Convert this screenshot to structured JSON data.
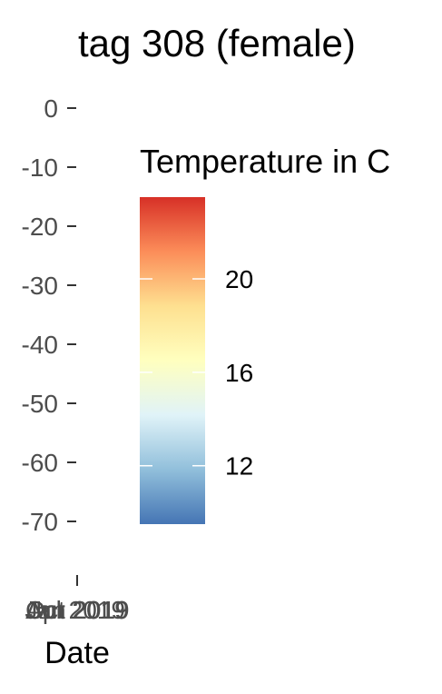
{
  "chart_data": {
    "type": "heatmap",
    "title": "tag 308 (female)",
    "xlabel": "Date",
    "ylabel": "",
    "ylim": [
      -70,
      0
    ],
    "y_ticks": [
      0,
      -10,
      -20,
      -30,
      -40,
      -50,
      -60,
      -70
    ],
    "x_tick_labels": [
      "Jul 2019",
      "Oct 2019",
      "Apr 2019",
      "Jan 2019"
    ],
    "x_tick_marks": 1,
    "grid": false,
    "legend": {
      "title": "Temperature in C",
      "position": "right",
      "range": [
        9.5,
        23.5
      ],
      "ticks": [
        12,
        16,
        20
      ],
      "colors": [
        "#4575b4",
        "#91bfdb",
        "#e0f3f8",
        "#ffffbf",
        "#fee090",
        "#fc8d59",
        "#d73027"
      ]
    }
  }
}
